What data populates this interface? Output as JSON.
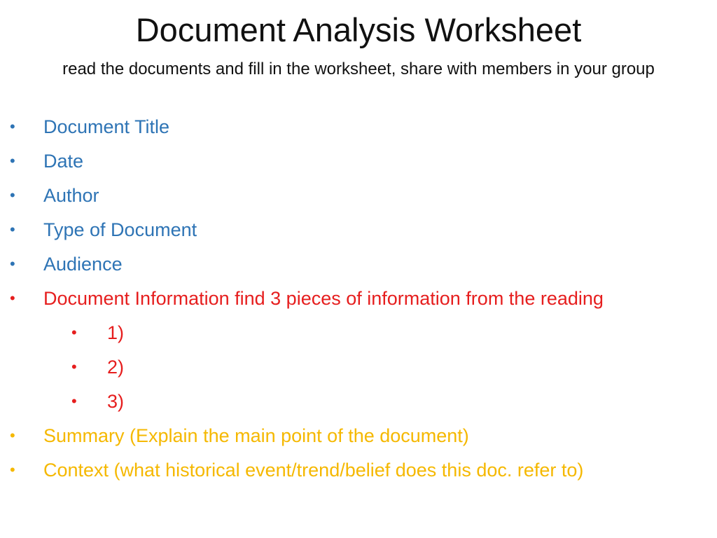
{
  "slide": {
    "title": "Document Analysis Worksheet",
    "subtitle": "read the documents and fill in the worksheet, share with members in your group"
  },
  "bullets": {
    "glyph": "•",
    "items": [
      {
        "text": "Document Title",
        "color": "#2e74b5"
      },
      {
        "text": "Date",
        "color": "#2e74b5"
      },
      {
        "text": "Author",
        "color": "#2e74b5"
      },
      {
        "text": "Type of Document",
        "color": "#2e74b5"
      },
      {
        "text": "Audience",
        "color": "#2e74b5"
      },
      {
        "text": "Document Information find 3 pieces of information from the reading",
        "color": "#e61e1e"
      },
      {
        "text": "1)",
        "color": "#e61e1e"
      },
      {
        "text": "2)",
        "color": "#e61e1e"
      },
      {
        "text": "3)",
        "color": "#e61e1e"
      },
      {
        "text": "Summary (Explain the main point of the document)",
        "color": "#f5b800"
      },
      {
        "text": "Context (what historical event/trend/belief does this doc. refer to)",
        "color": "#f5b800"
      }
    ]
  }
}
